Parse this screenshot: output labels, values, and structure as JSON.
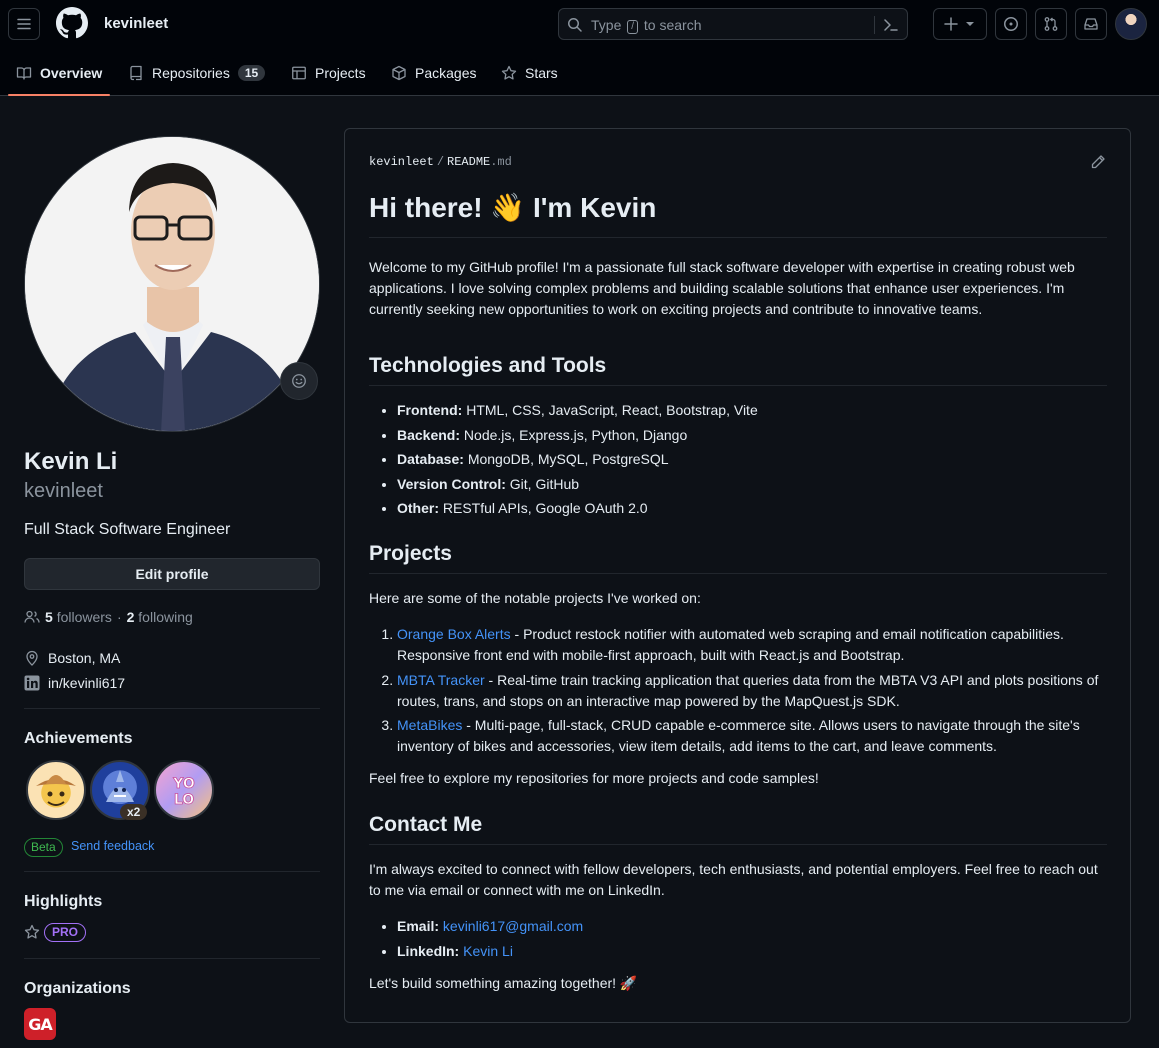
{
  "header": {
    "owner": "kevinleet",
    "search_prefix": "Type",
    "search_key": "/",
    "search_suffix": "to search"
  },
  "tabs": [
    {
      "label": "Overview",
      "icon": "book-icon",
      "active": true
    },
    {
      "label": "Repositories",
      "icon": "repo-icon",
      "count": "15"
    },
    {
      "label": "Projects",
      "icon": "table-icon"
    },
    {
      "label": "Packages",
      "icon": "package-icon"
    },
    {
      "label": "Stars",
      "icon": "star-icon"
    }
  ],
  "profile": {
    "name": "Kevin Li",
    "username": "kevinleet",
    "bio": "Full Stack Software Engineer",
    "edit_label": "Edit profile",
    "followers_count": "5",
    "followers_label": "followers",
    "separator": "·",
    "following_count": "2",
    "following_label": "following",
    "location": "Boston, MA",
    "linkedin": "in/kevinli617"
  },
  "achievements": {
    "heading": "Achievements",
    "badges": [
      "cowboy-badge",
      "shark-badge",
      "yolo-badge"
    ],
    "shark_count": "x2",
    "beta_label": "Beta",
    "feedback_label": "Send feedback"
  },
  "highlights": {
    "heading": "Highlights",
    "pro_label": "PRO"
  },
  "organizations": {
    "heading": "Organizations",
    "org_initials": "GA"
  },
  "readme": {
    "path_owner": "kevinleet",
    "path_sep": "/",
    "path_file": "README",
    "path_ext": ".md",
    "title": "Hi there! 👋 I'm Kevin",
    "intro": "Welcome to my GitHub profile! I'm a passionate full stack software developer with expertise in creating robust web applications. I love solving complex problems and building scalable solutions that enhance user experiences. I'm currently seeking new opportunities to work on exciting projects and contribute to innovative teams.",
    "tech_heading": "Technologies and Tools",
    "tech": [
      {
        "label": "Frontend:",
        "value": "HTML, CSS, JavaScript, React, Bootstrap, Vite"
      },
      {
        "label": "Backend:",
        "value": "Node.js, Express.js, Python, Django"
      },
      {
        "label": "Database:",
        "value": "MongoDB, MySQL, PostgreSQL"
      },
      {
        "label": "Version Control:",
        "value": "Git, GitHub"
      },
      {
        "label": "Other:",
        "value": "RESTful APIs, Google OAuth 2.0"
      }
    ],
    "projects_heading": "Projects",
    "projects_intro": "Here are some of the notable projects I've worked on:",
    "projects": [
      {
        "name": "Orange Box Alerts",
        "desc": " - Product restock notifier with automated web scraping and email notification capabilities. Responsive front end with mobile-first approach, built with React.js and Bootstrap."
      },
      {
        "name": "MBTA Tracker",
        "desc": " - Real-time train tracking application that queries data from the MBTA V3 API and plots positions of routes, trans, and stops on an interactive map powered by the MapQuest.js SDK."
      },
      {
        "name": "MetaBikes",
        "desc": " - Multi-page, full-stack, CRUD capable e-commerce site. Allows users to navigate through the site's inventory of bikes and accessories, view item details, add items to the cart, and leave comments."
      }
    ],
    "projects_outro": "Feel free to explore my repositories for more projects and code samples!",
    "contact_heading": "Contact Me",
    "contact_intro": "I'm always excited to connect with fellow developers, tech enthusiasts, and potential employers. Feel free to reach out to me via email or connect with me on LinkedIn.",
    "contacts": [
      {
        "label": "Email:",
        "value": "kevinli617@gmail.com"
      },
      {
        "label": "LinkedIn:",
        "value": "Kevin Li"
      }
    ],
    "closing": "Let's build something amazing together! 🚀"
  },
  "colors": {
    "background": "#0d1117",
    "header": "#010409",
    "border": "#30363d",
    "link": "#4493f8",
    "active_tab": "#f78166",
    "pro": "#a371f7",
    "beta": "#3fb950"
  }
}
